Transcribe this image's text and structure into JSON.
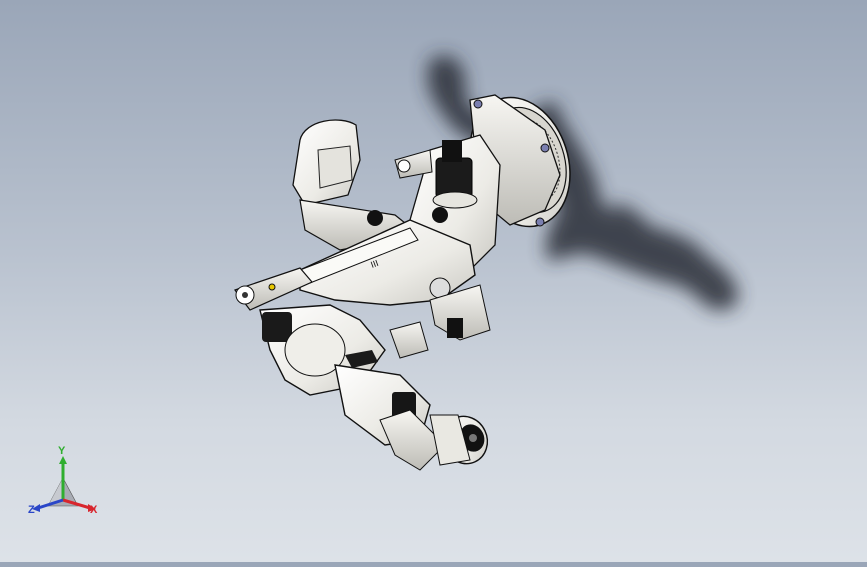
{
  "viewport": {
    "background_top": "#9aa6b8",
    "background_bottom": "#dde2e8",
    "model": "robot-arm-assembly",
    "shadow_color": "#2a2e38"
  },
  "triad": {
    "x_label": "X",
    "y_label": "Y",
    "z_label": "Z",
    "x_color": "#d8262e",
    "y_color": "#2fae2f",
    "z_color": "#2a46c8"
  }
}
